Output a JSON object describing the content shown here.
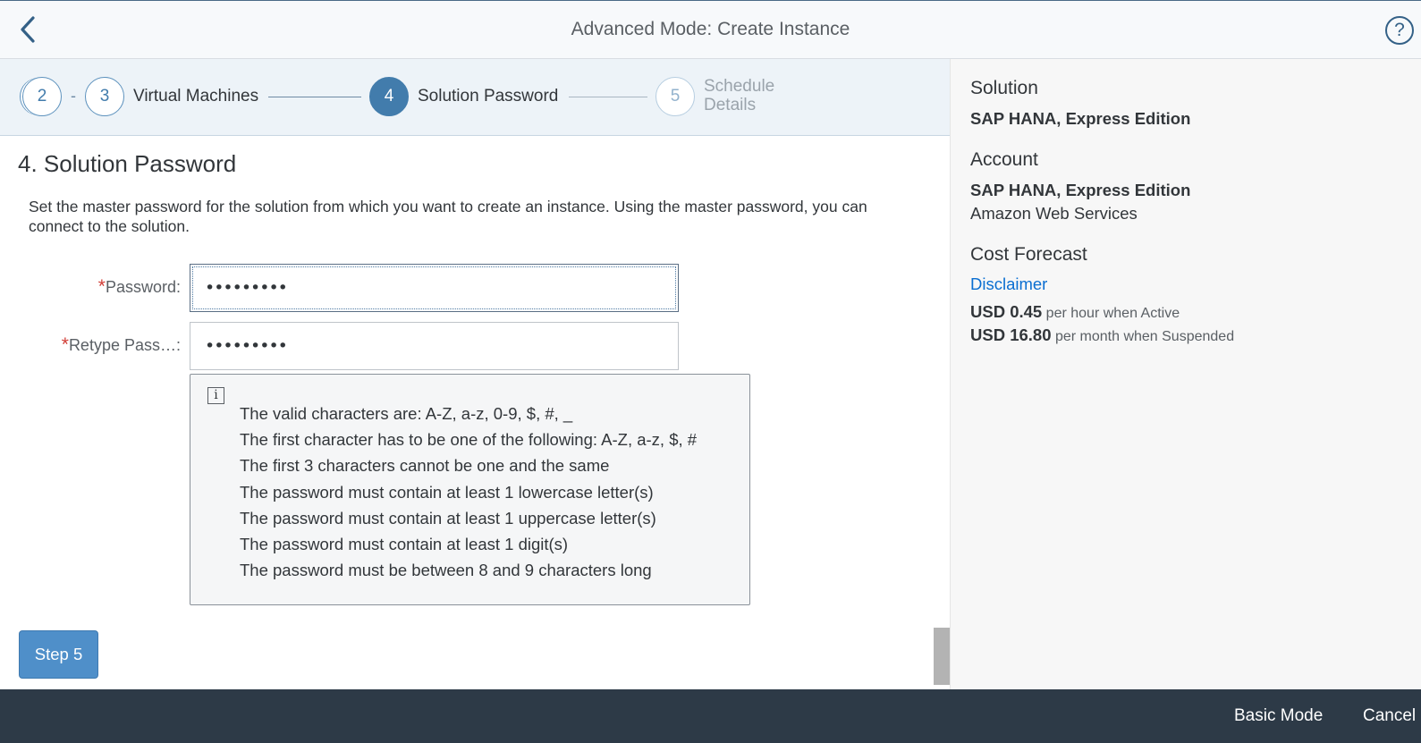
{
  "header": {
    "title": "Advanced Mode: Create Instance",
    "back_icon": "chevron-left-icon",
    "help_icon": "help-icon",
    "help_glyph": "?"
  },
  "wizard": {
    "steps": [
      {
        "number": "2",
        "label": "",
        "state": "done"
      },
      {
        "number": "3",
        "label": "Virtual Machines",
        "state": "done"
      },
      {
        "number": "4",
        "label": "Solution Password",
        "state": "current"
      },
      {
        "number": "5",
        "label_line1": "Schedule",
        "label_line2": "Details",
        "state": "future"
      }
    ],
    "dash": "-"
  },
  "main": {
    "title": "4. Solution Password",
    "description": "Set the master password for the solution from which you want to create an instance. Using the master password, you can connect to the solution.",
    "required_marker": "*",
    "password_label": "Password:",
    "password_value": "•••••••••",
    "retype_label": "Retype Pass…:",
    "retype_value": "•••••••••",
    "info_glyph": "i",
    "rules": [
      "The valid characters are: A-Z, a-z, 0-9, $, #, _",
      "The first character has to be one of the following: A-Z, a-z, $, #",
      "The first 3 characters cannot be one and the same",
      "The password must contain at least 1 lowercase letter(s)",
      "The password must contain at least 1 uppercase letter(s)",
      "The password must contain at least 1 digit(s)",
      "The password must be between 8 and 9 characters long"
    ],
    "next_button": "Step 5"
  },
  "side_panel": {
    "solution_heading": "Solution",
    "solution_name": "SAP HANA, Express Edition",
    "account_heading": "Account",
    "account_name": "SAP HANA, Express Edition",
    "account_provider": "Amazon Web Services",
    "cost_heading": "Cost Forecast",
    "disclaimer_link": "Disclaimer",
    "cost_active_amount": "USD 0.45",
    "cost_active_text": "per hour when Active",
    "cost_suspended_amount": "USD 16.80",
    "cost_suspended_text": "per month when Suspended"
  },
  "footer": {
    "basic_mode": "Basic Mode",
    "cancel": "Cancel"
  },
  "colors": {
    "accent": "#427cac",
    "link": "#0a6ed1",
    "required": "#d13d36",
    "footer_bg": "#2d3a47",
    "button_bg": "#4f8fc9"
  }
}
